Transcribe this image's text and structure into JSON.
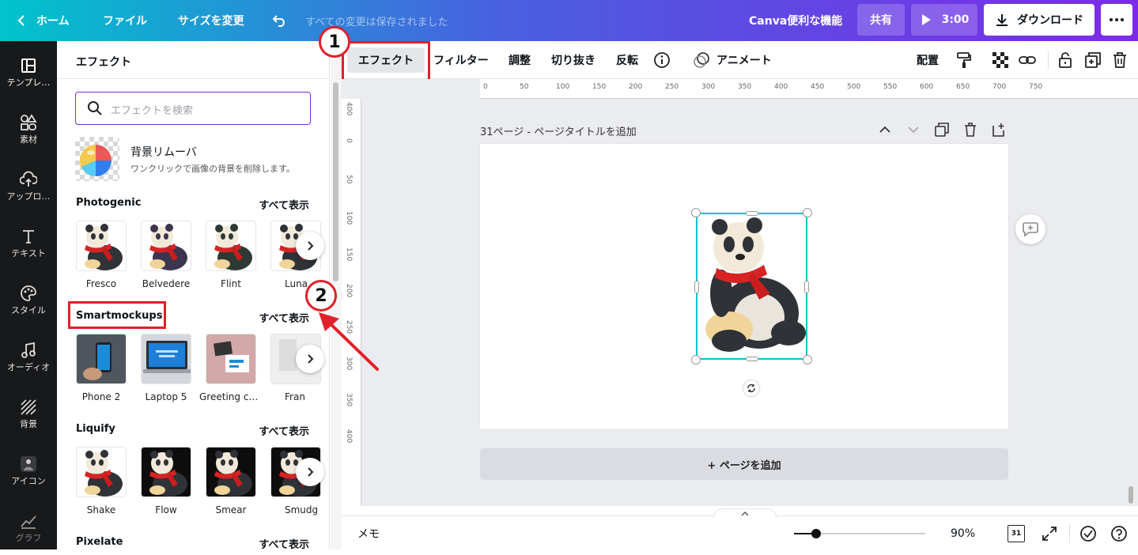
{
  "topbar": {
    "home": "ホーム",
    "file": "ファイル",
    "resize": "サイズを変更",
    "saved": "すべての変更は保存されました",
    "feature": "Canva便利な機能",
    "share": "共有",
    "play_time": "3:00",
    "download": "ダウンロード",
    "icons": [
      "chevron-left-icon",
      "undo-icon",
      "play-icon",
      "download-icon",
      "more-icon"
    ]
  },
  "rail": {
    "items": [
      {
        "label": "テンプレ…",
        "icon": "template-icon"
      },
      {
        "label": "素材",
        "icon": "elements-icon"
      },
      {
        "label": "アップロ…",
        "icon": "upload-icon"
      },
      {
        "label": "テキスト",
        "icon": "text-icon"
      },
      {
        "label": "スタイル",
        "icon": "style-icon"
      },
      {
        "label": "オーディオ",
        "icon": "audio-icon"
      },
      {
        "label": "背景",
        "icon": "background-icon"
      },
      {
        "label": "アイコン",
        "icon": "avatar-icon"
      },
      {
        "label": "グラフ",
        "icon": "chart-icon"
      }
    ]
  },
  "panel": {
    "title": "エフェクト",
    "search_placeholder": "エフェクトを検索",
    "bg_remover": {
      "title": "背景リムーバ",
      "desc": "ワンクリックで画像の背景を削除します。"
    },
    "sections": [
      {
        "title": "Photogenic",
        "see_all": "すべて表示",
        "items": [
          "Fresco",
          "Belvedere",
          "Flint",
          "Luna"
        ]
      },
      {
        "title": "Smartmockups",
        "see_all": "すべて表示",
        "items": [
          "Phone 2",
          "Laptop 5",
          "Greeting car...",
          "Fran"
        ]
      },
      {
        "title": "Liquify",
        "see_all": "すべて表示",
        "items": [
          "Shake",
          "Flow",
          "Smear",
          "Smudg"
        ]
      },
      {
        "title": "Pixelate",
        "see_all": "すべて表示"
      }
    ]
  },
  "context_toolbar": {
    "effects": "エフェクト",
    "filter": "フィルター",
    "adjust": "調整",
    "crop": "切り抜き",
    "flip": "反転",
    "animate": "アニメート",
    "position": "配置",
    "icons": [
      "info-icon",
      "animate-icon",
      "paint-roller-icon",
      "transparency-icon",
      "link-icon",
      "lock-icon",
      "duplicate-icon",
      "trash-icon"
    ]
  },
  "ruler": {
    "h": [
      "0",
      "50",
      "100",
      "150",
      "200",
      "250",
      "300",
      "350",
      "400",
      "450",
      "500",
      "550",
      "600",
      "650",
      "700",
      "750"
    ],
    "v": [
      "400",
      "0",
      "50",
      "100",
      "150",
      "200",
      "250",
      "300",
      "350",
      "400"
    ]
  },
  "canvas": {
    "page_label": "31ページ - ページタイトルを追加",
    "add_page": "+ ページを追加"
  },
  "bottombar": {
    "memo": "メモ",
    "zoom": "90%",
    "zoom_fraction": 0.17,
    "page_count": "31"
  },
  "annotations": {
    "n1": "1",
    "n2": "2",
    "accent": "#e0202a"
  },
  "colors": {
    "brand_teal": "#00c4cc",
    "brand_purple": "#7d2ae8",
    "rail_bg": "#18191b"
  }
}
